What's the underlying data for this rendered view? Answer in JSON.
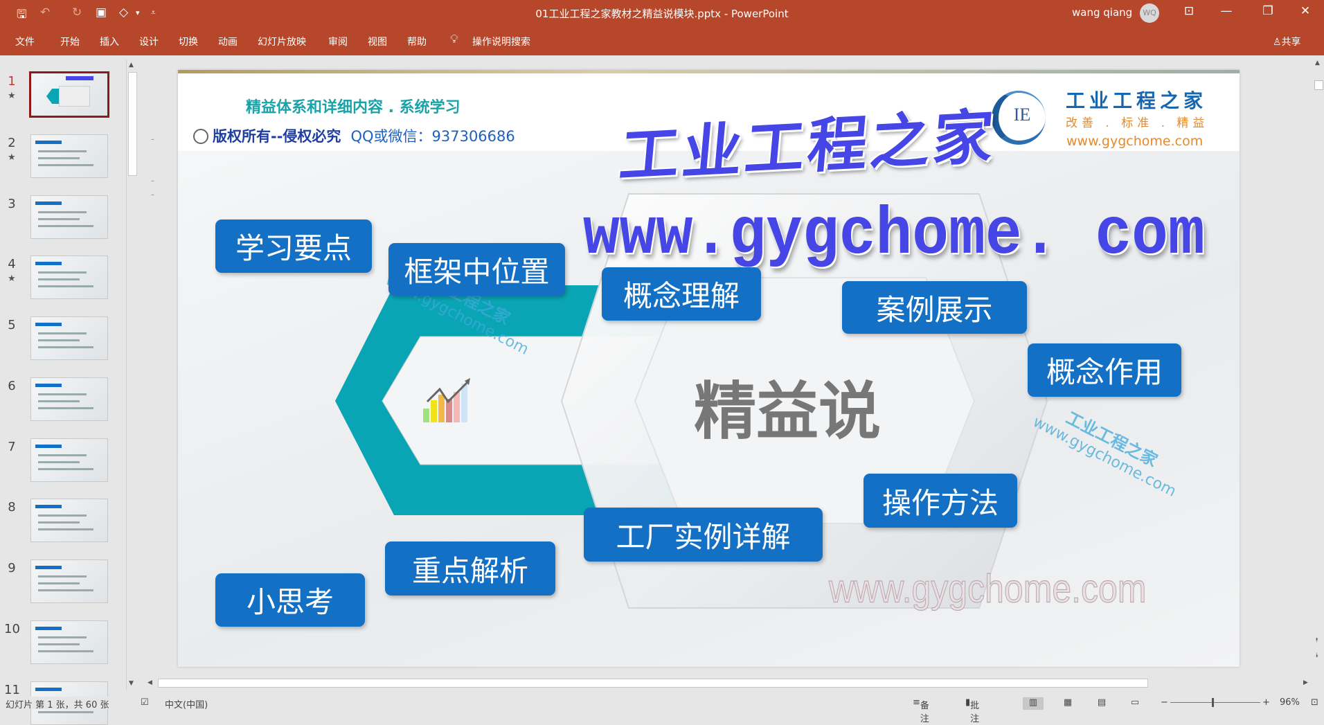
{
  "titlebar": {
    "doc_title": "01工业工程之家教材之精益说模块.pptx  -  PowerPoint",
    "user_name": "wang qiang",
    "avatar_initials": "WQ",
    "quick_access": {
      "save": "🖫",
      "undo": "↶",
      "redo": "↻",
      "present": "▣",
      "shapes": "◇",
      "dropdown": "▾",
      "customize": "⩡"
    },
    "window": {
      "ribbon_display": "⊡",
      "minimize": "—",
      "restore": "❐",
      "close": "✕"
    }
  },
  "ribbon": {
    "tabs": [
      "文件",
      "开始",
      "插入",
      "设计",
      "切换",
      "动画",
      "幻灯片放映",
      "审阅",
      "视图",
      "帮助"
    ],
    "tell_me": "操作说明搜索",
    "share": "共享",
    "accent": "#B7472A"
  },
  "thumbnails": [
    {
      "num": "1",
      "starred": true,
      "selected": true
    },
    {
      "num": "2",
      "starred": true
    },
    {
      "num": "3",
      "starred": false
    },
    {
      "num": "4",
      "starred": true
    },
    {
      "num": "5",
      "starred": false
    },
    {
      "num": "6",
      "starred": false
    },
    {
      "num": "7",
      "starred": false
    },
    {
      "num": "8",
      "starred": false
    },
    {
      "num": "9",
      "starred": false
    },
    {
      "num": "10",
      "starred": false
    },
    {
      "num": "11",
      "starred": false
    }
  ],
  "slide": {
    "header_line1": "精益体系和详细内容 . 系统学习",
    "header_copyright": "版权所有--侵权必究",
    "header_contact": "QQ或微信：937306686",
    "logo_mark": "IE",
    "logo_name": "工业工程之家",
    "logo_slogan": "改善 . 标准 . 精益",
    "logo_url": "www.gygchome.com",
    "watermark_big": "工业工程之家",
    "watermark_url": "www.gygchome. com",
    "watermark_bottom": "www.gygchome.com",
    "diag_watermark_name": "工业工程之家",
    "diag_watermark_url": "www.gygchome.com",
    "center_title": "精益说",
    "topics": [
      "学习要点",
      "框架中位置",
      "概念理解",
      "案例展示",
      "概念作用",
      "操作方法",
      "工厂实例详解",
      "重点解析",
      "小思考"
    ],
    "colors": {
      "topic_box": "#1470C4",
      "ring": "#0AA5B5",
      "center_text": "#777777",
      "watermark": "#4646E6"
    }
  },
  "status": {
    "slide_info": "幻灯片 第 1 张，共 60 张",
    "language": "中文(中国)",
    "notes": "备注",
    "comments": "批注",
    "zoom": "96%"
  }
}
